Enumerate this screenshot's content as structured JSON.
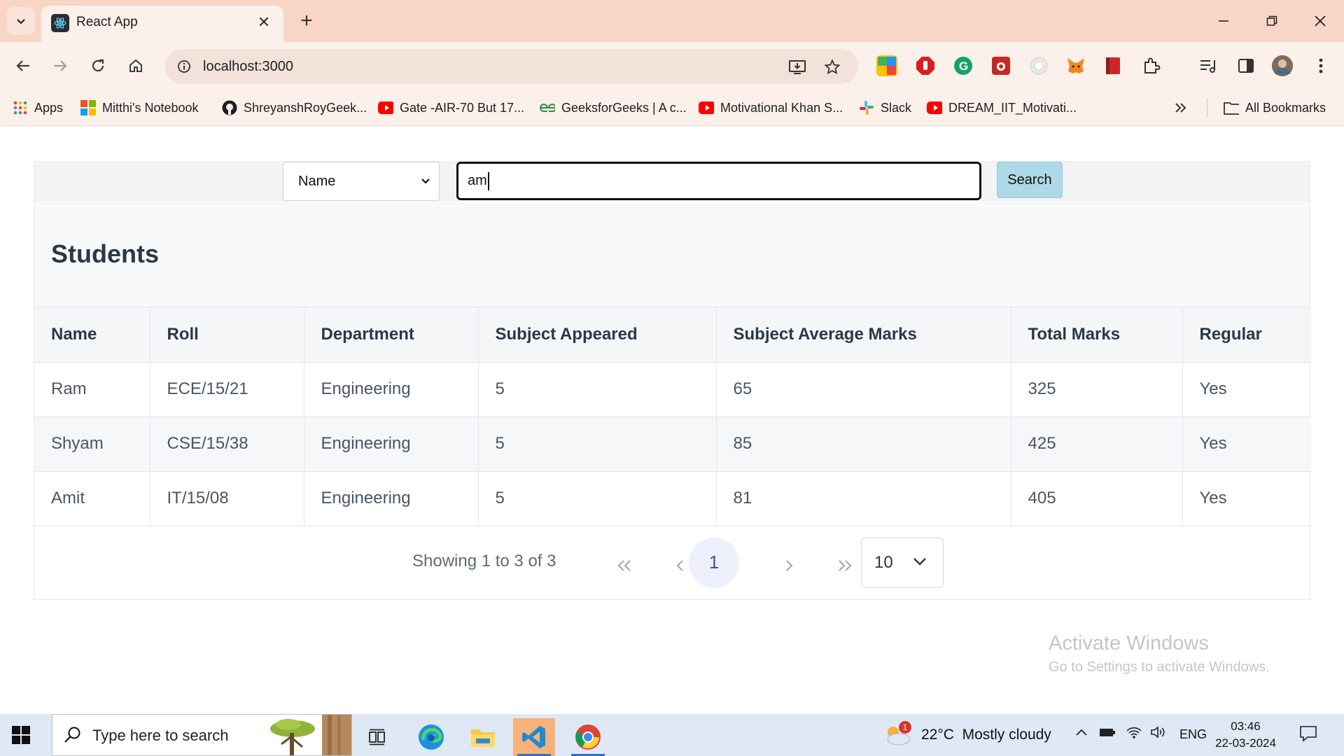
{
  "browser": {
    "tab_title": "React App",
    "url": "localhost:3000",
    "bookmarks": [
      {
        "label": "Apps",
        "icon": "apps-grid-icon"
      },
      {
        "label": "Mitthi's Notebook",
        "icon": "microsoft-icon"
      },
      {
        "label": "ShreyanshRoyGeek...",
        "icon": "github-icon"
      },
      {
        "label": "Gate -AIR-70 But 17...",
        "icon": "youtube-icon"
      },
      {
        "label": "GeeksforGeeks | A c...",
        "icon": "geeksforgeeks-icon"
      },
      {
        "label": "Motivational Khan S...",
        "icon": "youtube-icon"
      },
      {
        "label": "Slack",
        "icon": "slack-icon"
      },
      {
        "label": "DREAM_IIT_Motivati...",
        "icon": "youtube-icon"
      }
    ],
    "all_bookmarks_label": "All Bookmarks"
  },
  "search": {
    "field_selected": "Name",
    "query": "am",
    "button_label": "Search"
  },
  "table": {
    "title": "Students",
    "columns": [
      "Name",
      "Roll",
      "Department",
      "Subject Appeared",
      "Subject Average Marks",
      "Total Marks",
      "Regular"
    ],
    "rows": [
      [
        "Ram",
        "ECE/15/21",
        "Engineering",
        "5",
        "65",
        "325",
        "Yes"
      ],
      [
        "Shyam",
        "CSE/15/38",
        "Engineering",
        "5",
        "85",
        "425",
        "Yes"
      ],
      [
        "Amit",
        "IT/15/08",
        "Engineering",
        "5",
        "81",
        "405",
        "Yes"
      ]
    ]
  },
  "pagination": {
    "info": "Showing 1 to 3 of 3",
    "current_page": "1",
    "page_size": "10"
  },
  "watermark": {
    "line1": "Activate Windows",
    "line2": "Go to Settings to activate Windows."
  },
  "taskbar": {
    "search_placeholder": "Type here to search",
    "weather_badge": "1",
    "weather": "22°C  Mostly cloudy",
    "language": "ENG",
    "time": "03:46",
    "date": "22-03-2024"
  },
  "colors": {
    "tabstrip": "#f9d5c6",
    "toolbar": "#fcf0ea",
    "search_button": "#add8e6",
    "current_page_bg": "#eef0fb",
    "taskbar": "#dfe9f5"
  }
}
